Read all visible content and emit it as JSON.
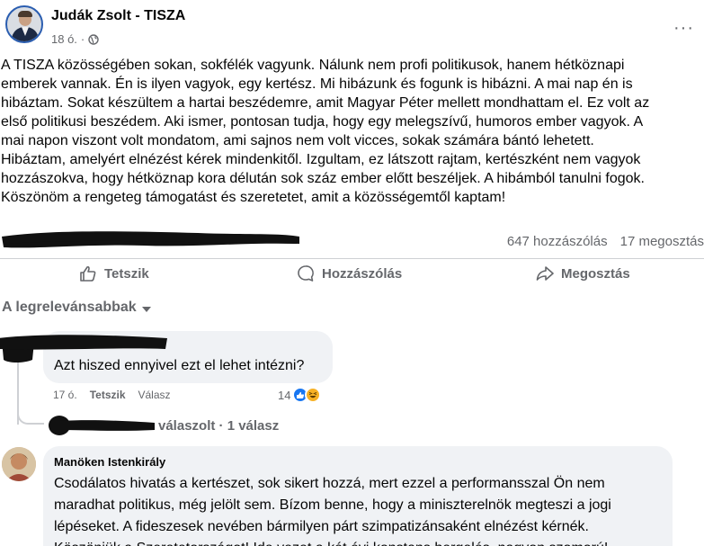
{
  "post": {
    "author": "Judák Zsolt - TISZA",
    "time": "18 ó.",
    "separator": "·",
    "more_label": "···",
    "text_lines": [
      "A TISZA közösségében sokan, sokfélék vagyunk. Nálunk nem profi politikusok, hanem hétköznapi",
      "emberek vannak. Én is ilyen vagyok, egy kertész. Mi hibázunk és fogunk is hibázni. A mai nap én is",
      "hibáztam. Sokat készültem a hartai beszédemre, amit Magyar Péter mellett mondhattam el. Ez volt az",
      "első politikusi beszédem. Aki ismer, pontosan tudja, hogy egy melegszívű, humoros ember vagyok. A",
      "mai napon viszont volt mondatom, ami sajnos nem volt vicces, sokak számára bántó lehetett.",
      "Hibáztam, amelyért elnézést kérek mindenkitől. Izgultam, ez látszott rajtam, kertészként nem vagyok",
      "hozzászokva, hogy hétköznap kora délután sok száz ember előtt beszéljek. A hibámból tanulni fogok.",
      "Köszönöm a rengeteg támogatást és szeretetet, amit a közösségemtől kaptam!"
    ],
    "comments_count": "647 hozzászólás",
    "shares_count": "17 megosztás"
  },
  "actions": {
    "like": "Tetszik",
    "comment": "Hozzászólás",
    "share": "Megosztás"
  },
  "sort": {
    "label": "A legrelevánsabbak"
  },
  "comments": [
    {
      "author": "",
      "text": "Azt hiszed ennyivel ezt el lehet intézni?",
      "time": "17 ó.",
      "like_label": "Tetszik",
      "reply_label": "Válasz",
      "reaction_count": "14",
      "replies_label": "válaszolt · 1 válasz"
    },
    {
      "author": "Manöken Istenkirály",
      "text_lines": [
        "Csodálatos hivatás a kertészet, sok sikert hozzá, mert ezzel a performansszal Ön nem",
        "maradhat politikus, még jelölt sem. Bízom benne, hogy a miniszterelnök megteszi a jogi",
        "lépéseket. A fideszesek nevében bármilyen párt szimpatizánsaként elnézést kérnék.",
        "Köszönjük a Szeretetországot! Ide vezet a két évi konstans hergelés, nagyon szomorú!"
      ]
    }
  ],
  "colors": {
    "text": "#050505",
    "secondary": "#65676b",
    "bubble": "#f0f2f5",
    "divider": "#ced0d4",
    "like_blue": "#1877f2",
    "haha_yellow": "#f7b125"
  }
}
